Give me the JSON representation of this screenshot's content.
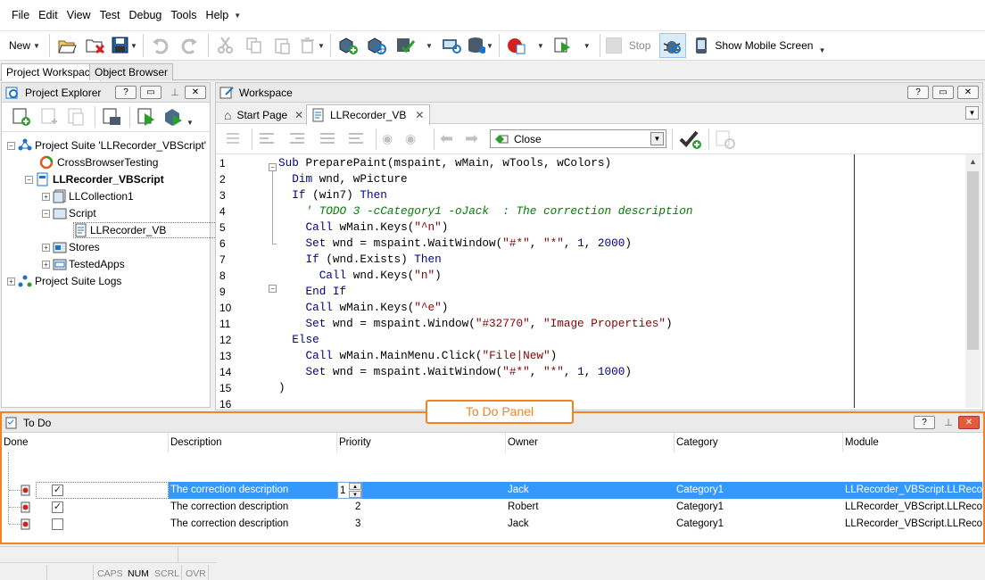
{
  "menu": [
    "File",
    "Edit",
    "View",
    "Test",
    "Debug",
    "Tools",
    "Help"
  ],
  "toolbar": {
    "new_label": "New",
    "stop_label": "Stop",
    "mobile_label": "Show Mobile Screen"
  },
  "tabs": [
    "Project Workspace",
    "Object Browser"
  ],
  "explorer": {
    "title": "Project Explorer",
    "tree": [
      "Project Suite 'LLRecorder_VBScript'",
      "CrossBrowserTesting",
      "LLRecorder_VBScript",
      "LLCollection1",
      "Script",
      "LLRecorder_VB",
      "Stores",
      "TestedApps",
      "Project Suite Logs"
    ]
  },
  "workspace": {
    "title": "Workspace",
    "tabs": [
      "Start Page",
      "LLRecorder_VB"
    ],
    "dropdown_value": "Close"
  },
  "code": {
    "line_numbers": [
      "1",
      "2",
      "3",
      "4",
      "5",
      "6",
      "7",
      "8",
      "9",
      "10",
      "11",
      "12",
      "13",
      "14",
      "15",
      "16"
    ]
  },
  "callout": "To Do Panel",
  "todo": {
    "title": "To Do",
    "columns": [
      "Done",
      "Description",
      "Priority",
      "Owner",
      "Category",
      "Module"
    ],
    "rows": [
      {
        "done": true,
        "description": "The correction description",
        "priority": "1",
        "owner": "Jack",
        "category": "Category1",
        "module": "LLRecorder_VBScript.LLRecorder_VB"
      },
      {
        "done": true,
        "description": "The correction description",
        "priority": "2",
        "owner": "Robert",
        "category": "Category1",
        "module": "LLRecorder_VBScript.LLRecorder_VB"
      },
      {
        "done": false,
        "description": "The correction description",
        "priority": "3",
        "owner": "Jack",
        "category": "Category1",
        "module": "LLRecorder_VBScript.LLRecorder_VB"
      }
    ]
  },
  "status": [
    "CAPS",
    "NUM",
    "SCRL",
    "OVR"
  ],
  "colors": {
    "accent": "#f58220",
    "selection": "#3399ff",
    "keyword": "#00008b",
    "string": "#8b0000",
    "comment": "#008000"
  }
}
